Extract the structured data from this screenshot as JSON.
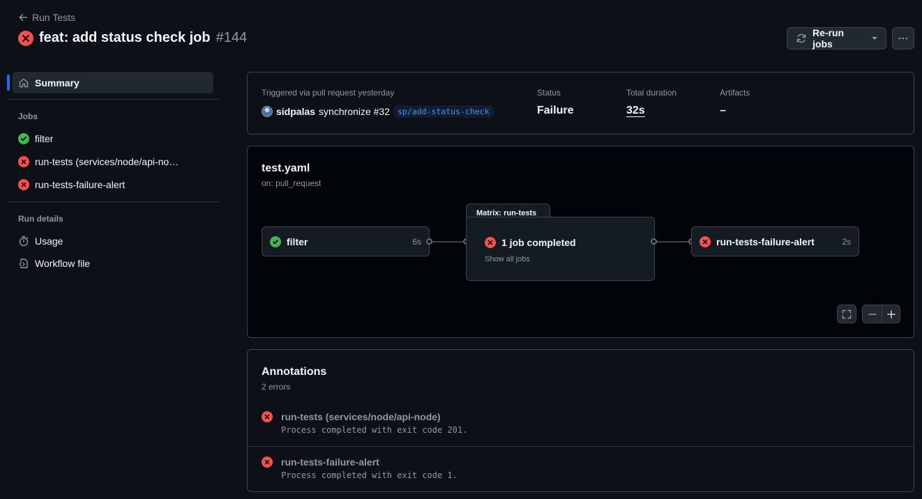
{
  "header": {
    "back_label": "Run Tests",
    "title": "feat: add status check job",
    "run_number": "#144",
    "rerun_label": "Re-run jobs"
  },
  "sidebar": {
    "summary_label": "Summary",
    "jobs_heading": "Jobs",
    "jobs": [
      {
        "label": "filter",
        "status": "success"
      },
      {
        "label": "run-tests (services/node/api-no…",
        "status": "failure"
      },
      {
        "label": "run-tests-failure-alert",
        "status": "failure"
      }
    ],
    "run_details_heading": "Run details",
    "run_details": [
      {
        "label": "Usage",
        "icon": "stopwatch-icon"
      },
      {
        "label": "Workflow file",
        "icon": "file-code-icon"
      }
    ]
  },
  "summary": {
    "trigger_label": "Triggered via pull request yesterday",
    "user": "sidpalas",
    "action": "synchronize #32",
    "branch": "sp/add-status-check",
    "status_label": "Status",
    "status_value": "Failure",
    "duration_label": "Total duration",
    "duration_value": "32s",
    "artifacts_label": "Artifacts",
    "artifacts_value": "–"
  },
  "graph": {
    "file": "test.yaml",
    "trigger": "on: pull_request",
    "jobs": [
      {
        "name": "filter",
        "duration": "6s",
        "status": "success"
      },
      {
        "name": "run-tests-failure-alert",
        "duration": "2s",
        "status": "failure"
      }
    ],
    "matrix": {
      "tab_label": "Matrix: run-tests",
      "summary": "1 job completed",
      "link": "Show all jobs",
      "status": "failure"
    }
  },
  "annotations": {
    "title": "Annotations",
    "count": "2 errors",
    "items": [
      {
        "name": "run-tests (services/node/api-node)",
        "message": "Process completed with exit code 201."
      },
      {
        "name": "run-tests-failure-alert",
        "message": "Process completed with exit code 1."
      }
    ]
  },
  "colors": {
    "background": "#0d1117",
    "failure": "#f85149",
    "success": "#3fb950",
    "accent": "#1f6feb",
    "link": "#4493f8"
  }
}
